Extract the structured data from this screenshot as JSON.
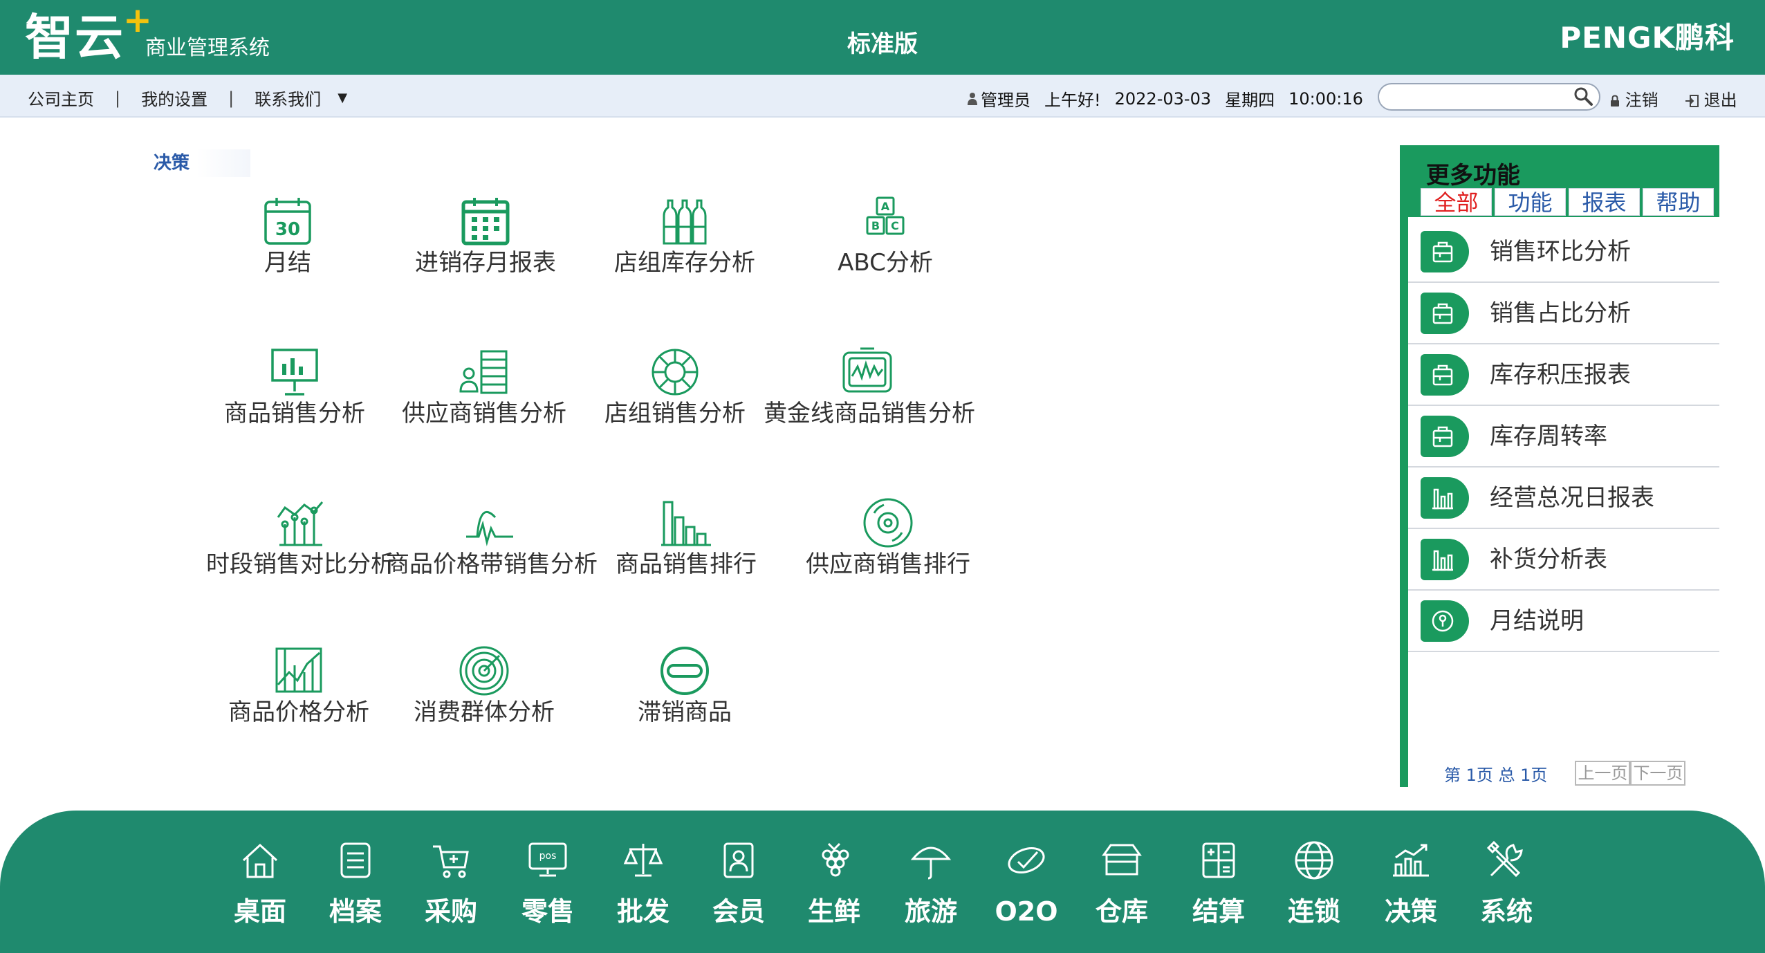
{
  "header": {
    "logo": "智云",
    "logo_plus": "+",
    "logo_subtitle": "商业管理系统",
    "edition": "标准版",
    "brand": "PENGK鹏科"
  },
  "toolbar": {
    "nav": [
      "公司主页",
      "我的设置",
      "联系我们"
    ],
    "separator": "|",
    "caret": "▼",
    "user": "管理员",
    "greeting": "上午好!",
    "date": "2022-03-03",
    "weekday": "星期四",
    "time": "10:00:16",
    "search_placeholder": "",
    "logout": "注销",
    "exit": "退出"
  },
  "main": {
    "section": "决策",
    "modules": [
      {
        "label": "月结",
        "icon": "calendar-icon"
      },
      {
        "label": "进销存月报表",
        "icon": "calendar-grid-icon"
      },
      {
        "label": "店组库存分析",
        "icon": "bottles-icon"
      },
      {
        "label": "ABC分析",
        "icon": "abc-blocks-icon"
      },
      {
        "label": "商品销售分析",
        "icon": "presentation-chart-icon"
      },
      {
        "label": "供应商销售分析",
        "icon": "supplier-list-icon"
      },
      {
        "label": "店组销售分析",
        "icon": "lifebuoy-icon"
      },
      {
        "label": "黄金线商品销售分析",
        "icon": "monitor-wave-icon"
      },
      {
        "label": "时段销售对比分析",
        "icon": "trend-compare-icon"
      },
      {
        "label": "商品价格带销售分析",
        "icon": "pulse-icon"
      },
      {
        "label": "商品销售排行",
        "icon": "ranking-bars-icon"
      },
      {
        "label": "供应商销售排行",
        "icon": "disc-icon"
      },
      {
        "label": "商品价格分析",
        "icon": "price-chart-icon"
      },
      {
        "label": "消费群体分析",
        "icon": "target-icon"
      },
      {
        "label": "滞销商品",
        "icon": "minus-circle-icon"
      }
    ]
  },
  "panel": {
    "title": "更多功能",
    "tabs": [
      "全部",
      "功能",
      "报表",
      "帮助"
    ],
    "active_tab": "全部",
    "items": [
      {
        "label": "销售环比分析",
        "icon": "bag-icon"
      },
      {
        "label": "销售占比分析",
        "icon": "bag-icon"
      },
      {
        "label": "库存积压报表",
        "icon": "bag-icon"
      },
      {
        "label": "库存周转率",
        "icon": "bag-icon"
      },
      {
        "label": "经营总况日报表",
        "icon": "bar-chart-icon"
      },
      {
        "label": "补货分析表",
        "icon": "bar-chart-icon"
      },
      {
        "label": "月结说明",
        "icon": "help-icon"
      }
    ],
    "pager_text": "第 1页 总 1页",
    "prev": "上一页",
    "next": "下一页"
  },
  "dock": [
    {
      "label": "桌面",
      "icon": "home-icon"
    },
    {
      "label": "档案",
      "icon": "file-list-icon"
    },
    {
      "label": "采购",
      "icon": "cart-icon"
    },
    {
      "label": "零售",
      "icon": "pos-icon"
    },
    {
      "label": "批发",
      "icon": "scale-icon"
    },
    {
      "label": "会员",
      "icon": "member-card-icon"
    },
    {
      "label": "生鲜",
      "icon": "grapes-icon"
    },
    {
      "label": "旅游",
      "icon": "umbrella-icon"
    },
    {
      "label": "O2O",
      "icon": "o2o-icon"
    },
    {
      "label": "仓库",
      "icon": "warehouse-icon"
    },
    {
      "label": "结算",
      "icon": "calculator-icon"
    },
    {
      "label": "连锁",
      "icon": "globe-icon"
    },
    {
      "label": "决策",
      "icon": "decision-chart-icon"
    },
    {
      "label": "系统",
      "icon": "tools-icon"
    }
  ],
  "colors": {
    "header_green": "#1f8a6e",
    "panel_green": "#1a9a5e",
    "icon_green": "#1a9a5e",
    "link_blue": "#2a5aa8",
    "active_tab_red": "#e02020"
  }
}
